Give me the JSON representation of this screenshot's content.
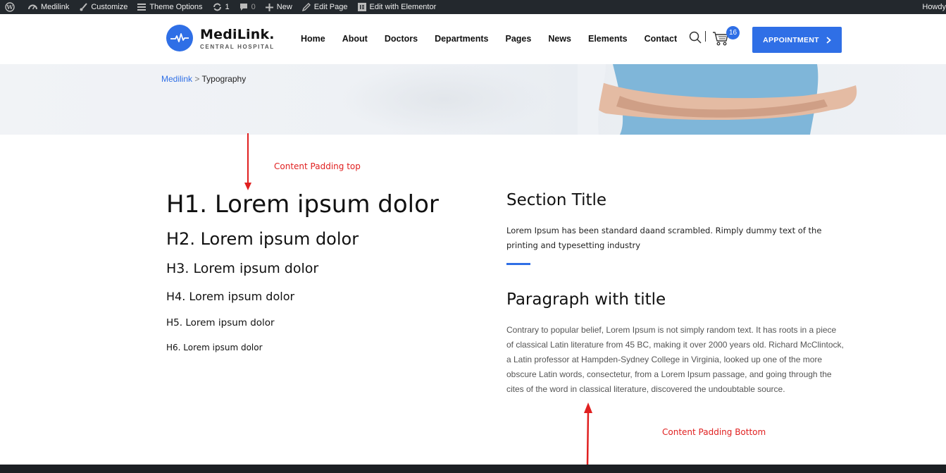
{
  "admin_bar": {
    "site_name": "Medilink",
    "customize": "Customize",
    "theme_options": "Theme Options",
    "updates_count": "1",
    "comments_count": "0",
    "new": "New",
    "edit_page": "Edit Page",
    "edit_elementor": "Edit with Elementor",
    "howdy": "Howdy"
  },
  "header": {
    "logo_name": "MediLink.",
    "logo_sub": "CENTRAL HOSPITAL",
    "nav": [
      "Home",
      "About",
      "Doctors",
      "Departments",
      "Pages",
      "News",
      "Elements",
      "Contact"
    ],
    "cart_count": "16",
    "appointment_label": "APPOINTMENT",
    "accent_color": "#2f6fe6"
  },
  "breadcrumb": {
    "home": "Medilink",
    "separator": ">",
    "current": "Typography"
  },
  "headings": {
    "h1": "H1. Lorem ipsum dolor",
    "h2": "H2. Lorem ipsum dolor",
    "h3": "H3. Lorem ipsum dolor",
    "h4": "H4. Lorem ipsum dolor",
    "h5": "H5. Lorem ipsum dolor",
    "h6": "H6. Lorem ipsum dolor"
  },
  "section": {
    "title": "Section Title",
    "text": "Lorem Ipsum has been standard daand scrambled. Rimply dummy text of the printing and typesetting industry"
  },
  "paragraph": {
    "title": "Paragraph with title",
    "text": "Contrary to popular belief, Lorem Ipsum is not simply random text. It has roots in a piece of classical Latin literature from 45 BC, making it over 2000 years old. Richard McClintock, a Latin professor at Hampden-Sydney College in Virginia, looked up one of the more obscure Latin words, consectetur, from a Lorem Ipsum passage, and going through the cites of the word in classical literature, discovered the undoubtable source."
  },
  "annotations": {
    "top": "Content Padding top",
    "bottom": "Content Padding Bottom",
    "color": "#e02020"
  }
}
